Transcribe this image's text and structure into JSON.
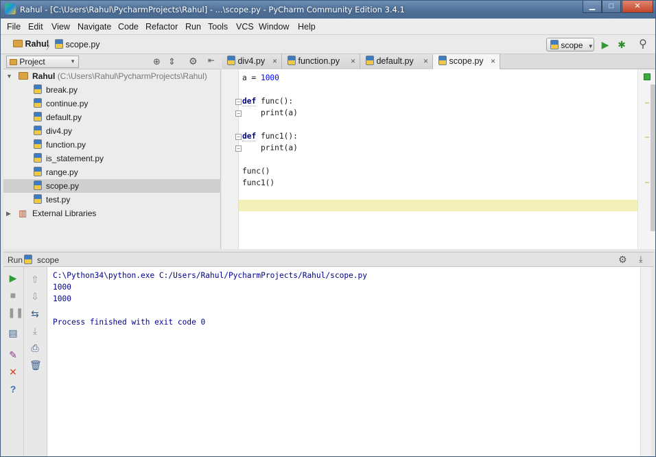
{
  "window": {
    "title": "Rahul - [C:\\Users\\Rahul\\PycharmProjects\\Rahul] - ...\\scope.py - PyCharm Community Edition 3.4.1",
    "controls": {
      "minimize": "▁",
      "maximize": "□",
      "close": "✕"
    }
  },
  "menu": [
    "File",
    "Edit",
    "View",
    "Navigate",
    "Code",
    "Refactor",
    "Run",
    "Tools",
    "VCS",
    "Window",
    "Help"
  ],
  "breadcrumb": {
    "project": "Rahul",
    "separator": "〉",
    "file": "scope.py"
  },
  "toolbar": {
    "run_config": "scope",
    "run_icon": "▶",
    "debug_icon": "✱",
    "search_icon": "⚲"
  },
  "project_panel": {
    "combo_label": "Project",
    "root": {
      "name": "Rahul",
      "path": "(C:\\Users\\Rahul\\PycharmProjects\\Rahul)"
    },
    "files": [
      "break.py",
      "continue.py",
      "default.py",
      "div4.py",
      "function.py",
      "is_statement.py",
      "range.py",
      "scope.py",
      "test.py"
    ],
    "selected": "scope.py",
    "external": "External Libraries"
  },
  "editor": {
    "tabs": [
      {
        "label": "div4.py",
        "active": false
      },
      {
        "label": "function.py",
        "active": false
      },
      {
        "label": "default.py",
        "active": false
      },
      {
        "label": "scope.py",
        "active": true
      }
    ],
    "tab_close": "×",
    "code": {
      "line1_var": "a = ",
      "line1_num": "1000",
      "def_kw": "def",
      "func_sig": " func():",
      "func_body": "    print(a)",
      "func1_sig": " func1():",
      "func1_body": "    print(a)",
      "call1": "func()",
      "call2": "func1()"
    }
  },
  "run_panel": {
    "title": "Run",
    "config": "scope",
    "output": [
      "C:\\Python34\\python.exe C:/Users/Rahul/PycharmProjects/Rahul/scope.py",
      "1000",
      "1000",
      "",
      "Process finished with exit code 0"
    ]
  }
}
